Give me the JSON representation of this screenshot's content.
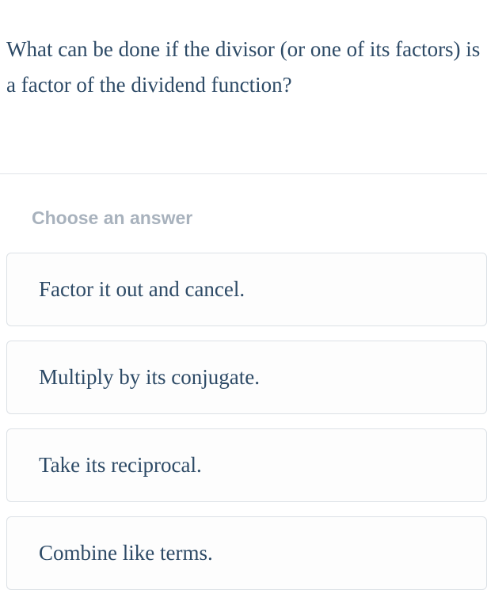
{
  "question": {
    "text": "What can be done if the divisor (or one of its factors) is a factor of the dividend function?"
  },
  "instruction": "Choose an answer",
  "answers": [
    {
      "text": "Factor it out and cancel."
    },
    {
      "text": "Multiply by its conjugate."
    },
    {
      "text": "Take its reciprocal."
    },
    {
      "text": "Combine like terms."
    }
  ]
}
